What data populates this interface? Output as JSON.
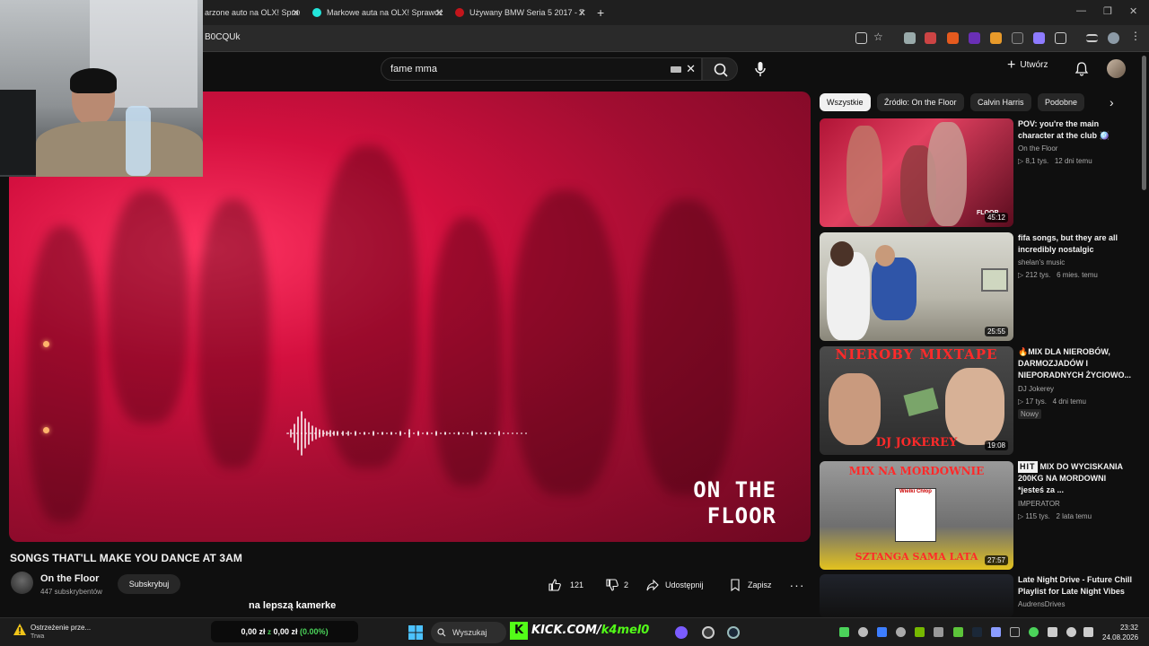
{
  "browser": {
    "tabs": [
      {
        "title": "arzone auto na OLX! Spraw"
      },
      {
        "title": "Markowe auta na OLX! Sprawdź"
      },
      {
        "title": "Używany BMW Seria 5 2017 - 7"
      }
    ],
    "new_tab_label": "+",
    "url": "B0CQUk"
  },
  "youtube": {
    "search": {
      "query": "fame mma"
    },
    "create_label": "Utwórz",
    "chips": [
      "Wszystkie",
      "Źródło: On the Floor",
      "Calvin Harris",
      "Podobne"
    ],
    "video": {
      "title": "SONGS THAT'LL MAKE YOU DANCE AT 3AM",
      "overlay_line1": "ON THE",
      "overlay_line2": "FLOOR",
      "channel": "On the Floor",
      "subscribers": "447 subskrybentów",
      "subscribe_label": "Subskrybuj",
      "likes": "121",
      "dislikes": "2",
      "share_label": "Udostępnij",
      "save_label": "Zapisz",
      "more_label": "···"
    },
    "recommendations": [
      {
        "title": "POV: you're the main character at the club 🪩",
        "channel": "On the Floor",
        "views": "8,1 tys.",
        "age": "12 dni temu",
        "duration": "45:12",
        "badge": ""
      },
      {
        "title": "fifa songs, but they are all incredibly nostalgic",
        "channel": "shelan's music",
        "views": "212 tys.",
        "age": "6 mies. temu",
        "duration": "25:55",
        "badge": ""
      },
      {
        "title": "🔥MIX DLA NIEROBÓW, DARMOZJADÓW I NIEPORADNYCH ŻYCIOWO...",
        "channel": "DJ Jokerey",
        "views": "17 tys.",
        "age": "4 dni temu",
        "duration": "19:08",
        "badge": "Nowy"
      },
      {
        "title": "MIX DO WYCISKANIA 200KG NA MORDOWNI *jesteś za ...",
        "channel": "IMPERATOR",
        "views": "115 tys.",
        "age": "2 lata temu",
        "duration": "27:57",
        "badge": ""
      },
      {
        "title": "Late Night Drive - Future Chill Playlist for Late Night Vibes",
        "channel": "AudrensDrives",
        "views": "",
        "age": "",
        "duration": "",
        "badge": ""
      }
    ],
    "thumb_texts": {
      "t3_top": "NIEROBY MIXTAPE",
      "t3_bottom": "DJ JOKEREY",
      "t4_top": "MIX NA MORDOWNIE",
      "t4_box": "Wielki Chłop",
      "t4_bottom": "SZTANGA SAMA LATA",
      "t1_logo": "FLOOR",
      "hit_label": "HIT"
    }
  },
  "stream_overlay": {
    "text": "na lepszą kamerke"
  },
  "taskbar": {
    "warning_title": "Ostrzeżenie prze...",
    "warning_sub": "Trwa",
    "price_a": "0,00 zł",
    "price_sep": "z",
    "price_b": "0,00 zł",
    "price_pct": "(0.00%)",
    "search_label": "Wyszukaj",
    "kick_brand": "KICK.COM/",
    "kick_name": "k4mel0",
    "time": "23:32",
    "date": "24.08.2026"
  },
  "colors": {
    "youtube_bg": "#0f0f0f",
    "kick_green": "#53fc18",
    "percent_green": "#4bd35a",
    "video_red": "#d4103f"
  }
}
